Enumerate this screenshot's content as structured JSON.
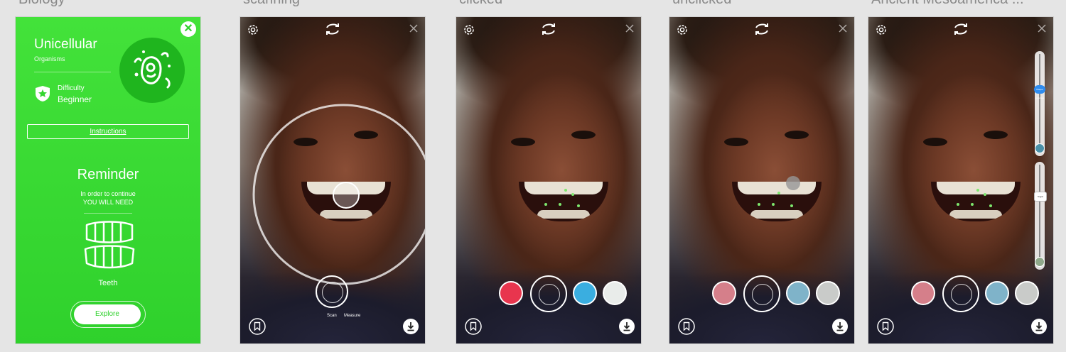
{
  "frames": [
    {
      "title": "Biology"
    },
    {
      "title": "scanning"
    },
    {
      "title": "clicked"
    },
    {
      "title": "unclicked"
    },
    {
      "title": "Ancient Mesoamerica ..."
    }
  ],
  "panel": {
    "title": "Unicellular",
    "subtitle": "Organisms",
    "difficulty_label": "Difficulty",
    "difficulty_value": "Beginner",
    "instructions": "Instructions",
    "reminder": "Reminder",
    "need_line1": "In order to continue",
    "need_line2": "YOU WILL NEED",
    "item": "Teeth",
    "explore": "Explore"
  },
  "camera": {
    "scan_label": "Scan",
    "measure_label": "Measure",
    "slider1_label": "Plaque coverage",
    "slider2_label": "Sugar"
  },
  "colors": {
    "panel_green": "#3ad834",
    "accent_red": "#e8354e",
    "accent_blue": "#3aaee0",
    "slider_blue": "#2e8cf0"
  },
  "icons": [
    "close-icon",
    "microbe-icon",
    "shield-star-icon",
    "teeth-icon",
    "settings-icon",
    "swap-camera-icon",
    "bookmark-icon",
    "download-icon"
  ]
}
